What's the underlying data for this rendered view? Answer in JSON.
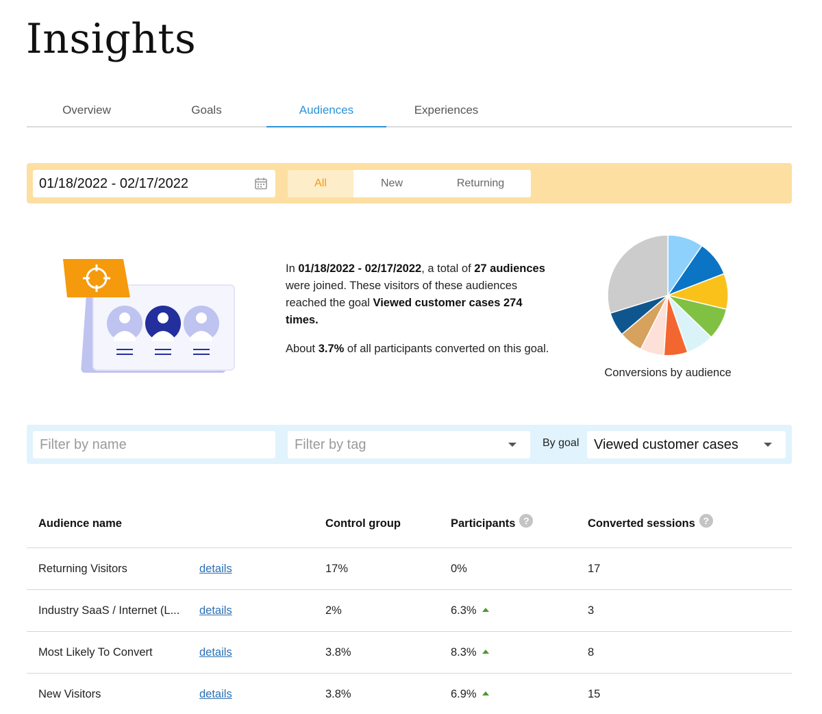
{
  "page": {
    "title": "Insights"
  },
  "tabs": [
    {
      "label": "Overview",
      "active": false
    },
    {
      "label": "Goals",
      "active": false
    },
    {
      "label": "Audiences",
      "active": true
    },
    {
      "label": "Experiences",
      "active": false
    }
  ],
  "date_filter": {
    "range": "01/18/2022 - 02/17/2022",
    "icon": "calendar-icon",
    "segments": [
      {
        "label": "All",
        "active": true
      },
      {
        "label": "New",
        "active": false
      },
      {
        "label": "Returning",
        "active": false
      }
    ]
  },
  "summary": {
    "p1_in": "In ",
    "p1_range": "01/18/2022 - 02/17/2022",
    "p1_mid": ", a total of ",
    "p1_count": "27 audiences",
    "p1_joined": " were joined. These visitors of these audiences reached the goal ",
    "p1_goal": "Viewed customer cases 274 times.",
    "p2_about": "About ",
    "p2_pct": "3.7%",
    "p2_rest": " of all participants converted on this goal."
  },
  "chart_data": {
    "type": "pie",
    "title": "Conversions by audience",
    "slices": [
      {
        "value": 9,
        "color": "#8ed1fc"
      },
      {
        "value": 9,
        "color": "#0b74c4"
      },
      {
        "value": 9,
        "color": "#fbc11b"
      },
      {
        "value": 8,
        "color": "#80c143"
      },
      {
        "value": 7,
        "color": "#daf3f9"
      },
      {
        "value": 6,
        "color": "#f3662f"
      },
      {
        "value": 6,
        "color": "#fde0d8"
      },
      {
        "value": 6,
        "color": "#d7a25e"
      },
      {
        "value": 6,
        "color": "#0f568f"
      },
      {
        "value": 28,
        "color": "#cccccc"
      }
    ]
  },
  "filters": {
    "name_placeholder": "Filter by name",
    "tag_placeholder": "Filter by tag",
    "by_goal_label": "By goal",
    "goal_value": "Viewed customer cases"
  },
  "table": {
    "headers": {
      "name": "Audience name",
      "control": "Control group",
      "participants": "Participants",
      "converted": "Converted sessions"
    },
    "rows": [
      {
        "name": "Returning Visitors",
        "link": "details",
        "control": "17%",
        "participants": "0%",
        "trend_up": false,
        "converted": "17"
      },
      {
        "name": "Industry SaaS / Internet (L...",
        "link": "details",
        "control": "2%",
        "participants": "6.3%",
        "trend_up": true,
        "converted": "3"
      },
      {
        "name": "Most Likely To Convert",
        "link": "details",
        "control": "3.8%",
        "participants": "8.3%",
        "trend_up": true,
        "converted": "8"
      },
      {
        "name": "New Visitors",
        "link": "details",
        "control": "3.8%",
        "participants": "6.9%",
        "trend_up": true,
        "converted": "15"
      }
    ]
  },
  "colors": {
    "accent_blue": "#2a93d8",
    "date_bar_bg": "#fddfa2",
    "active_segment": "#f29811",
    "filter_bar_bg": "#e1f3fc",
    "trend_up": "#4a9b2a",
    "link": "#2b6fb3"
  }
}
